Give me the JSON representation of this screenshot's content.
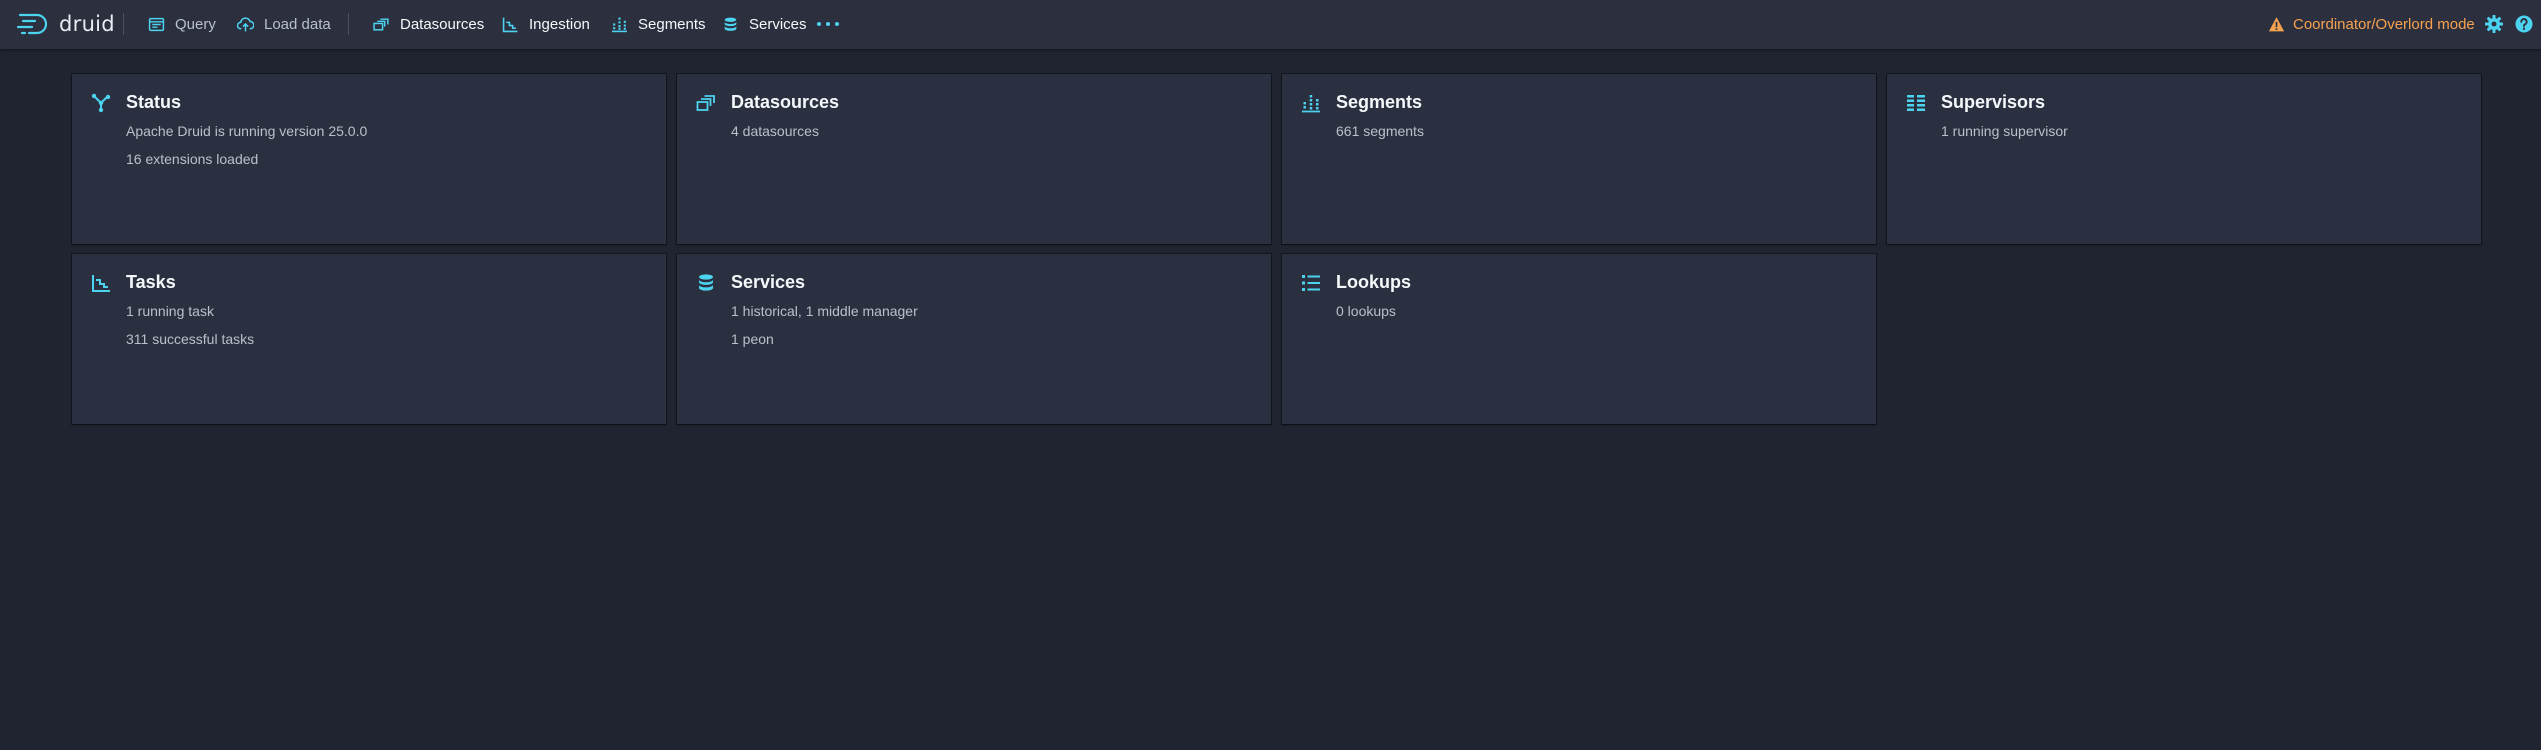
{
  "header": {
    "logo_text": "druid",
    "nav": [
      {
        "label": "Query",
        "icon": "query-icon"
      },
      {
        "label": "Load data",
        "icon": "cloud-upload-icon"
      },
      {
        "label": "Datasources",
        "icon": "datasources-icon"
      },
      {
        "label": "Ingestion",
        "icon": "ingestion-icon"
      },
      {
        "label": "Segments",
        "icon": "segments-icon"
      },
      {
        "label": "Services",
        "icon": "services-icon"
      }
    ],
    "more_icon": "more-icon",
    "mode_label": "Coordinator/Overlord mode",
    "settings_icon": "gear-icon",
    "help_icon": "help-icon"
  },
  "cards": [
    {
      "title": "Status",
      "icon": "status-icon",
      "lines": [
        "Apache Druid is running version 25.0.0",
        "16 extensions loaded"
      ]
    },
    {
      "title": "Datasources",
      "icon": "datasources-icon",
      "lines": [
        "4 datasources"
      ]
    },
    {
      "title": "Segments",
      "icon": "segments-icon",
      "lines": [
        "661 segments"
      ]
    },
    {
      "title": "Supervisors",
      "icon": "supervisors-icon",
      "lines": [
        "1 running supervisor"
      ]
    },
    {
      "title": "Tasks",
      "icon": "tasks-icon",
      "lines": [
        "1 running task",
        "311 successful tasks"
      ]
    },
    {
      "title": "Services",
      "icon": "services-icon",
      "lines": [
        "1 historical, 1 middle manager",
        "1 peon"
      ]
    },
    {
      "title": "Lookups",
      "icon": "lookups-icon",
      "lines": [
        "0 lookups"
      ]
    }
  ],
  "colors": {
    "accent": "#4cd3f0",
    "warning": "#f7a250",
    "header_bg": "#2b2f3e",
    "page_bg": "#202430",
    "card_bg": "#2b3040"
  }
}
